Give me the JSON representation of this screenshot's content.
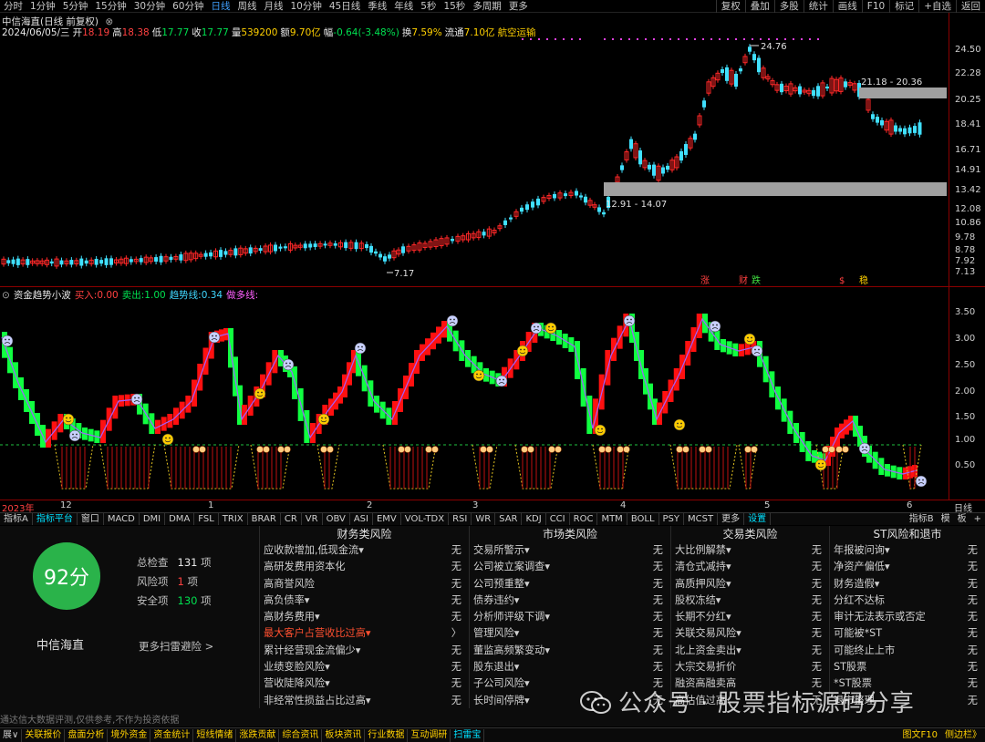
{
  "topbar": {
    "timeframes": [
      "分时",
      "1分钟",
      "5分钟",
      "15分钟",
      "30分钟",
      "60分钟",
      "日线",
      "周线",
      "月线",
      "10分钟",
      "45日线",
      "季线",
      "年线",
      "5秒",
      "15秒",
      "多周期",
      "更多"
    ],
    "active_timeframe": "日线",
    "right_buttons": [
      "复权",
      "叠加",
      "多股",
      "统计",
      "画线",
      "F10",
      "标记",
      "+自选",
      "返回"
    ]
  },
  "header": {
    "title": "中信海直(日线 前复权)",
    "close_glyph": "⊗",
    "date": "2024/06/05/三",
    "open_label": "开",
    "open": "18.19",
    "high_label": "高",
    "high": "18.38",
    "low_label": "低",
    "low": "17.77",
    "close_label": "收",
    "close": "17.77",
    "volume_label": "量",
    "volume": "539200",
    "amount_label": "额",
    "amount": "9.70亿",
    "change_label": "幅",
    "change": "-0.64(-3.48%)",
    "turnover_label": "换",
    "turnover": "7.59%",
    "float_label": "流通",
    "float": "7.10亿",
    "sector": "航空运输"
  },
  "price_axis": {
    "ticks": [
      "24.50",
      "22.28",
      "20.25",
      "18.41",
      "16.71",
      "14.91",
      "13.42",
      "12.08",
      "10.86",
      "9.78",
      "8.78",
      "7.92",
      "7.13"
    ]
  },
  "price_annotations": {
    "peak": "24.76",
    "low": "7.17",
    "zone_high": "21.18 - 20.36",
    "zone_low": "12.91 - 14.07",
    "markers": [
      "涨",
      "财",
      "跌",
      "$",
      "稳"
    ]
  },
  "indicator": {
    "name": "资金趋势小波",
    "buy_label": "买入:",
    "buy": "0.00",
    "sell_label": "卖出:",
    "sell": "1.00",
    "trend_label": "趋势线:",
    "trend": "0.34",
    "extra_label": "做多线:",
    "ticks": [
      "3.50",
      "3.00",
      "2.50",
      "2.00",
      "1.50",
      "1.00",
      "0.50"
    ]
  },
  "date_axis": {
    "labels": [
      "2023年",
      "12",
      "1",
      "2",
      "3",
      "4",
      "5",
      "6"
    ],
    "right_label": "日线"
  },
  "tabs": {
    "items": [
      "指标A",
      "指标平台",
      "窗口",
      "MACD",
      "DMI",
      "DMA",
      "FSL",
      "TRIX",
      "BRAR",
      "CR",
      "VR",
      "OBV",
      "ASI",
      "EMV",
      "VOL-TDX",
      "RSI",
      "WR",
      "SAR",
      "KDJ",
      "CCI",
      "ROC",
      "MTM",
      "BOLL",
      "PSY",
      "MCST",
      "更多",
      "设置"
    ],
    "active": "指标平台",
    "right": [
      "指标B",
      "模",
      "板",
      "+"
    ]
  },
  "risk_panel": {
    "score": "92分",
    "stock_name": "中信海直",
    "total_label": "总检查",
    "total": "131",
    "total_unit": "项",
    "risk_label": "风险项",
    "risk": "1",
    "risk_unit": "项",
    "safe_label": "安全项",
    "safe": "130",
    "safe_unit": "项",
    "more": "更多扫雷避险 >",
    "disclaimer": "通达信大数据评测,仅供参考,不作为投资依据",
    "columns": [
      {
        "title": "财务类风险",
        "rows": [
          {
            "label": "应收款增加,低现金流▾",
            "result": "无"
          },
          {
            "label": "高研发费用资本化",
            "result": "无"
          },
          {
            "label": "高商誉风险",
            "result": "无"
          },
          {
            "label": "高负债率▾",
            "result": "无"
          },
          {
            "label": "高财务费用▾",
            "result": "无"
          },
          {
            "label": "最大客户占营收比过高▾",
            "result": "〉",
            "warn": true
          },
          {
            "label": "累计经营现金流偏少▾",
            "result": "无"
          },
          {
            "label": "业绩变脸风险▾",
            "result": "无"
          },
          {
            "label": "营收陡降风险▾",
            "result": "无"
          },
          {
            "label": "非经常性损益占比过高▾",
            "result": "无"
          }
        ]
      },
      {
        "title": "市场类风险",
        "rows": [
          {
            "label": "交易所警示▾",
            "result": "无"
          },
          {
            "label": "公司被立案调查▾",
            "result": "无"
          },
          {
            "label": "公司预重整▾",
            "result": "无"
          },
          {
            "label": "债券违约▾",
            "result": "无"
          },
          {
            "label": "分析师评级下调▾",
            "result": "无"
          },
          {
            "label": "管理风险▾",
            "result": "无"
          },
          {
            "label": "董监高频繁变动▾",
            "result": "无"
          },
          {
            "label": "股东退出▾",
            "result": "无"
          },
          {
            "label": "子公司风险▾",
            "result": "无"
          },
          {
            "label": "长时间停牌▾",
            "result": "无"
          }
        ]
      },
      {
        "title": "交易类风险",
        "rows": [
          {
            "label": "大比例解禁▾",
            "result": "无"
          },
          {
            "label": "清仓式减持▾",
            "result": "无"
          },
          {
            "label": "高质押风险▾",
            "result": "无"
          },
          {
            "label": "股权冻结▾",
            "result": "无"
          },
          {
            "label": "长期不分红▾",
            "result": "无"
          },
          {
            "label": "关联交易风险▾",
            "result": "无"
          },
          {
            "label": "北上资金卖出▾",
            "result": "无"
          },
          {
            "label": "大宗交易折价",
            "result": "无"
          },
          {
            "label": "融资高融卖高",
            "result": "无"
          },
          {
            "label": "高估值过高",
            "result": "无"
          }
        ]
      },
      {
        "title": "ST风险和退市",
        "rows": [
          {
            "label": "年报被问询▾",
            "result": "无"
          },
          {
            "label": "净资产偏低▾",
            "result": "无"
          },
          {
            "label": "财务造假▾",
            "result": "无"
          },
          {
            "label": "分红不达标",
            "result": "无"
          },
          {
            "label": "审计无法表示或否定",
            "result": "无"
          },
          {
            "label": "可能被*ST",
            "result": "无"
          },
          {
            "label": "可能终止上市",
            "result": "无"
          },
          {
            "label": "ST股票",
            "result": "无"
          },
          {
            "label": "*ST股票",
            "result": "无"
          },
          {
            "label": "退市整理",
            "result": "无"
          }
        ]
      }
    ]
  },
  "watermark": "公众号 · 股票指标源码分享",
  "bottombar": {
    "items": [
      "展∨",
      "关联报价",
      "盘面分析",
      "境外资金",
      "资金统计",
      "短线情绪",
      "涨跌贡献",
      "综合资讯",
      "板块资讯",
      "行业数据",
      "互动调研",
      "扫雷宝"
    ],
    "active": "扫雷宝",
    "right": [
      "图文F10",
      "侧边栏》"
    ]
  },
  "colors": {
    "up": "#ff2020",
    "down": "#00e0ff",
    "wave_up": "#ff0000",
    "wave_down": "#00ff40",
    "score_bg": "#2ab34a"
  }
}
